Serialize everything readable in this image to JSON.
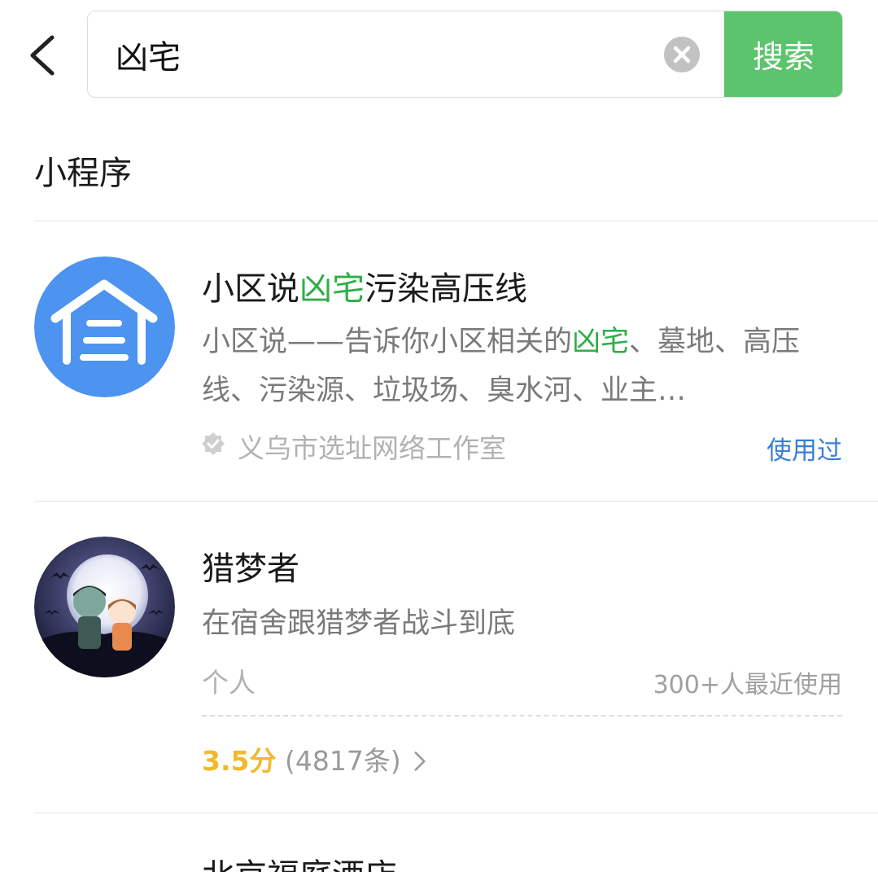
{
  "search": {
    "query": "凶宅",
    "button_label": "搜索"
  },
  "section": {
    "title": "小程序"
  },
  "results": [
    {
      "title_prefix": "小区说",
      "title_highlight": "凶宅",
      "title_suffix": "污染高压线",
      "desc_prefix": "小区说——告诉你小区相关的",
      "desc_highlight": "凶宅",
      "desc_suffix": "、墓地、高压线、污染源、垃圾场、臭水河、业主…",
      "publisher": "义乌市选址网络工作室",
      "status": "使用过",
      "icon": "house-icon",
      "verified_icon": "verified-badge-icon"
    },
    {
      "title": "猎梦者",
      "desc": "在宿舍跟猎梦者战斗到底",
      "publisher": "个人",
      "recent_users": "300+人最近使用",
      "rating_score": "3.5分",
      "rating_count": "(4817条)",
      "icon": "moon-night-avatar"
    },
    {
      "title": "北京福庭酒店"
    }
  ],
  "colors": {
    "accent_green": "#5cc46c",
    "highlight_green": "#2fae48",
    "link_blue": "#3b7fd4",
    "rating_gold": "#f0b92e"
  }
}
